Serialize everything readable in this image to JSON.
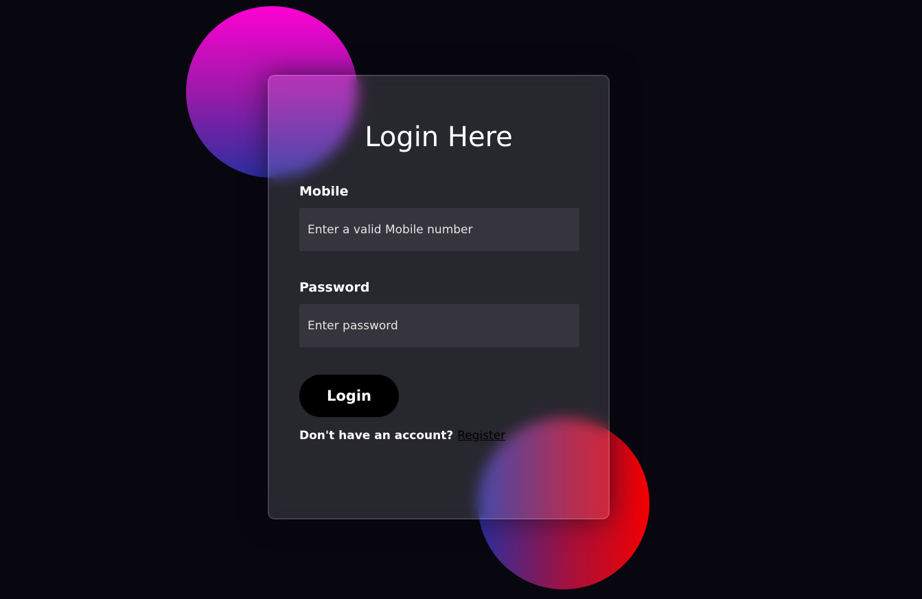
{
  "form": {
    "title": "Login Here",
    "mobile": {
      "label": "Mobile",
      "placeholder": "Enter a valid Mobile number",
      "value": ""
    },
    "password": {
      "label": "Password",
      "placeholder": "Enter password",
      "value": ""
    },
    "login_button": "Login",
    "register_prompt": "Don't have an account?",
    "register_link": "Register"
  },
  "colors": {
    "background": "#080710",
    "shape_top": [
      "#ff00d4",
      "#2a2fa0"
    ],
    "shape_bottom": [
      "#2a2fa0",
      "#f20000"
    ],
    "button": "#000000"
  }
}
